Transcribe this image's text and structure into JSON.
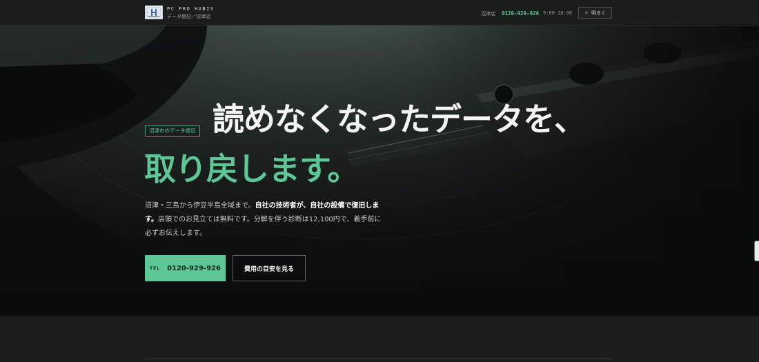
{
  "header": {
    "brand_name": "PC PRO HABIS",
    "brand_sub": "データ復旧／沼津店",
    "store": "沼津店",
    "phone": "0120-929-926",
    "hours": "9:00-18:00",
    "theme_button": "明るく",
    "theme_icon": "sun-icon"
  },
  "hero": {
    "tag": "沼津市のデータ復旧",
    "headline_line1": "読めなくなったデータを、",
    "headline_line2": "取り戻します。",
    "description": {
      "part1": "沼津・三島から伊豆半島全域まで。",
      "part2": "自社の技術者が、自社の設備で復旧します。",
      "part3": "店頭でのお見立ては無料です。分解を伴う診断は12,100円で、着手前に必ずお伝えします。"
    },
    "tel_button": {
      "label": "TEL",
      "number": "0120-929-926"
    },
    "price_button": "費用の目安を見る"
  },
  "colors": {
    "accent": "#5ec796",
    "background": "#1c1d1d",
    "header_bg": "#1b1c1c"
  }
}
